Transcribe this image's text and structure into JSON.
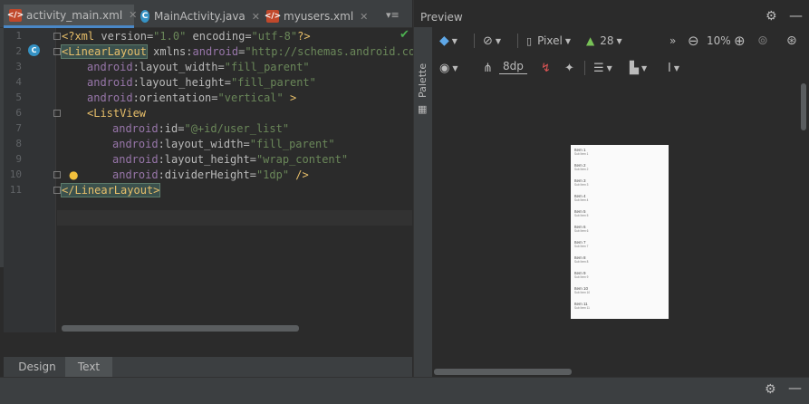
{
  "editor": {
    "tabs": [
      {
        "label": "activity_main.xml",
        "icon": "xml-file-icon",
        "active": true
      },
      {
        "label": "MainActivity.java",
        "icon": "java-class-icon",
        "active": false
      },
      {
        "label": "myusers.xml",
        "icon": "xml-file-icon",
        "active": false
      }
    ],
    "tab_close": "✕",
    "tab_menu": "▾≡",
    "line_numbers": [
      "1",
      "2",
      "3",
      "4",
      "5",
      "6",
      "7",
      "8",
      "9",
      "10",
      "11"
    ],
    "lines": {
      "l1": {
        "pi_open": "<?",
        "tag": "xml",
        "a1": " version=",
        "v1": "\"1.0\"",
        "a2": " encoding=",
        "v2": "\"utf-8\"",
        "pi_close": "?>"
      },
      "l2": {
        "open": "<",
        "tag": "LinearLayout",
        "a1": " xmlns:",
        "ns": "android",
        "a1b": "=",
        "v1": "\"http://schemas.android.com/"
      },
      "l3": {
        "ns": "android",
        "attr": ":layout_width=",
        "val": "\"fill_parent\""
      },
      "l4": {
        "ns": "android",
        "attr": ":layout_height=",
        "val": "\"fill_parent\""
      },
      "l5": {
        "ns": "android",
        "attr": ":orientation=",
        "val": "\"vertical\"",
        "close": " >"
      },
      "l6": {
        "open": "<",
        "tag": "ListView"
      },
      "l7": {
        "ns": "android",
        "attr": ":id=",
        "val": "\"@+id/user_list\""
      },
      "l8": {
        "ns": "android",
        "attr": ":layout_width=",
        "val": "\"fill_parent\""
      },
      "l9": {
        "ns": "android",
        "attr": ":layout_height=",
        "val": "\"wrap_content\""
      },
      "l10": {
        "ns": "android",
        "attr": ":dividerHeight=",
        "val": "\"1dp\"",
        "close": " />"
      },
      "l11": {
        "open": "</",
        "tag": "LinearLayout",
        "close": ">"
      }
    },
    "design_tab": "Design",
    "text_tab": "Text",
    "status_check": "✔"
  },
  "preview": {
    "title": "Preview",
    "palette_label": "Palette",
    "toolbar1": {
      "device": "Pixel",
      "api_level": "28",
      "overflow": "»",
      "zoom": "10%"
    },
    "toolbar2": {
      "margin": "8dp"
    },
    "list_items": [
      {
        "title": "Item 1",
        "subtitle": "Sub Item 1"
      },
      {
        "title": "Item 2",
        "subtitle": "Sub Item 2"
      },
      {
        "title": "Item 3",
        "subtitle": "Sub Item 3"
      },
      {
        "title": "Item 4",
        "subtitle": "Sub Item 4"
      },
      {
        "title": "Item 5",
        "subtitle": "Sub Item 5"
      },
      {
        "title": "Item 6",
        "subtitle": "Sub Item 6"
      },
      {
        "title": "Item 7",
        "subtitle": "Sub Item 7"
      },
      {
        "title": "Item 8",
        "subtitle": "Sub Item 8"
      },
      {
        "title": "Item 9",
        "subtitle": "Sub Item 9"
      },
      {
        "title": "Item 10",
        "subtitle": "Sub Item 10"
      },
      {
        "title": "Item 11",
        "subtitle": "Sub Item 11"
      }
    ]
  },
  "colors": {
    "background": "#2b2b2b",
    "tag": "#e8bf6a",
    "namespace": "#9876aa",
    "value": "#6a8759",
    "accent": "#4a88c7"
  }
}
